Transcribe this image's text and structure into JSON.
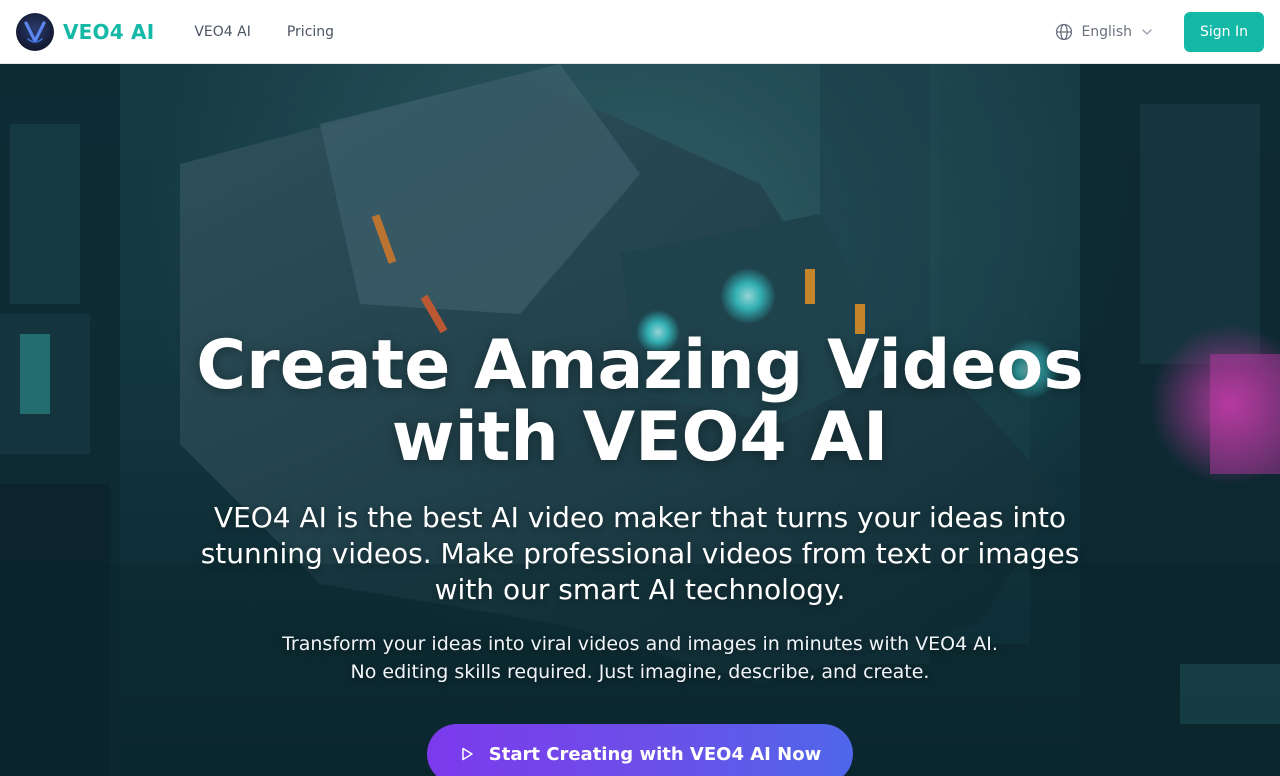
{
  "header": {
    "brand": "VEO4 AI",
    "nav": [
      {
        "label": "VEO4 AI"
      },
      {
        "label": "Pricing"
      }
    ],
    "language": "English",
    "sign_in": "Sign In"
  },
  "hero": {
    "title": "Create Amazing Videos with VEO4 AI",
    "subtitle": "VEO4 AI is the best AI video maker that turns your ideas into stunning videos. Make professional videos from text or images with our smart AI technology.",
    "description_line1": "Transform your ideas into viral videos and images in minutes with VEO4 AI.",
    "description_line2": "No editing skills required. Just imagine, describe, and create.",
    "cta": "Start Creating with VEO4 AI Now"
  },
  "colors": {
    "brand": "#14b8a6",
    "cta_start": "#7c3aed",
    "cta_end": "#4f67ea"
  },
  "icons": {
    "logo": "veo4-logo",
    "language": "globe-icon",
    "dropdown": "chevron-down-icon",
    "cta": "play-icon"
  }
}
